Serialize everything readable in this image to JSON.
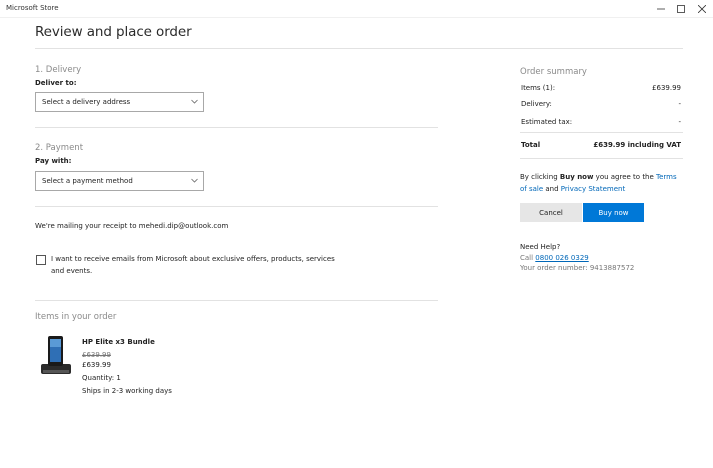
{
  "window": {
    "app_title": "Microsoft Store"
  },
  "page": {
    "title": "Review and place order"
  },
  "delivery": {
    "section": "1. Delivery",
    "label": "Deliver to:",
    "select_value": "Select a delivery address"
  },
  "payment": {
    "section": "2. Payment",
    "label": "Pay with:",
    "select_value": "Select a payment method"
  },
  "receipt": {
    "text": "We're mailing your receipt to mehedi.dip@outlook.com"
  },
  "consent": {
    "text": "I want to receive emails from Microsoft about exclusive offers, products, services and events.",
    "checked": false
  },
  "items": {
    "section": "Items in your order",
    "list": [
      {
        "name": "HP Elite x3 Bundle",
        "original_price": "£639.99",
        "price": "£639.99",
        "quantity": "Quantity: 1",
        "shipping": "Ships in 2-3 working days"
      }
    ]
  },
  "summary": {
    "title": "Order summary",
    "items_label": "Items (1):",
    "items_value": "£639.99",
    "delivery_label": "Delivery:",
    "delivery_value": "-",
    "tax_label": "Estimated tax:",
    "tax_value": "-",
    "total_label": "Total",
    "total_value": "£639.99 including VAT",
    "terms_prefix": "By clicking ",
    "terms_bold": "Buy now",
    "terms_middle": " you agree to the ",
    "terms_link": "Terms of sale",
    "terms_and": " and ",
    "privacy_link": "Privacy Statement"
  },
  "actions": {
    "cancel": "Cancel",
    "buy_now": "Buy now"
  },
  "help": {
    "title": "Need Help?",
    "call_prefix": "Call ",
    "phone": "0800 026 0329",
    "order_number": "Your order number: 9413887572"
  },
  "colors": {
    "accent": "#0078d7",
    "link": "#0067b8"
  },
  "icons": [
    "minimize-icon",
    "maximize-icon",
    "close-icon",
    "chevron-down-icon",
    "checkbox-icon"
  ]
}
